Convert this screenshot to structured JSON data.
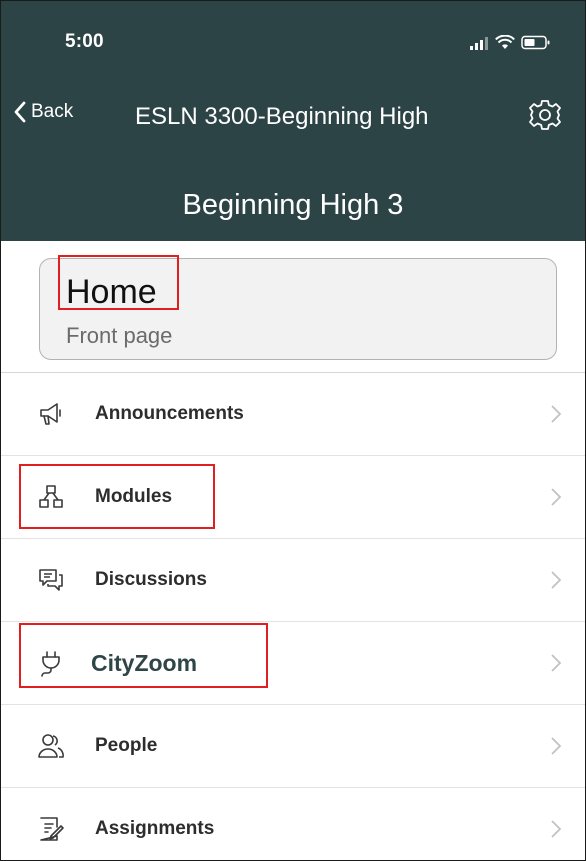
{
  "status": {
    "time": "5:00"
  },
  "nav": {
    "back_label": "Back",
    "title": "ESLN 3300-Beginning High",
    "settings_icon": "gear-icon"
  },
  "subtitle": "Beginning High 3",
  "home": {
    "title": "Home",
    "subtitle": "Front page"
  },
  "menu": {
    "items": [
      {
        "label": "Announcements",
        "icon": "megaphone-icon"
      },
      {
        "label": "Modules",
        "icon": "modules-icon"
      },
      {
        "label": "Discussions",
        "icon": "discussions-icon"
      },
      {
        "label": "CityZoom",
        "icon": "plug-icon"
      },
      {
        "label": "People",
        "icon": "people-icon"
      },
      {
        "label": "Assignments",
        "icon": "assignments-icon"
      }
    ]
  },
  "colors": {
    "header_bg": "#2d4446",
    "highlight": "#e02020"
  }
}
